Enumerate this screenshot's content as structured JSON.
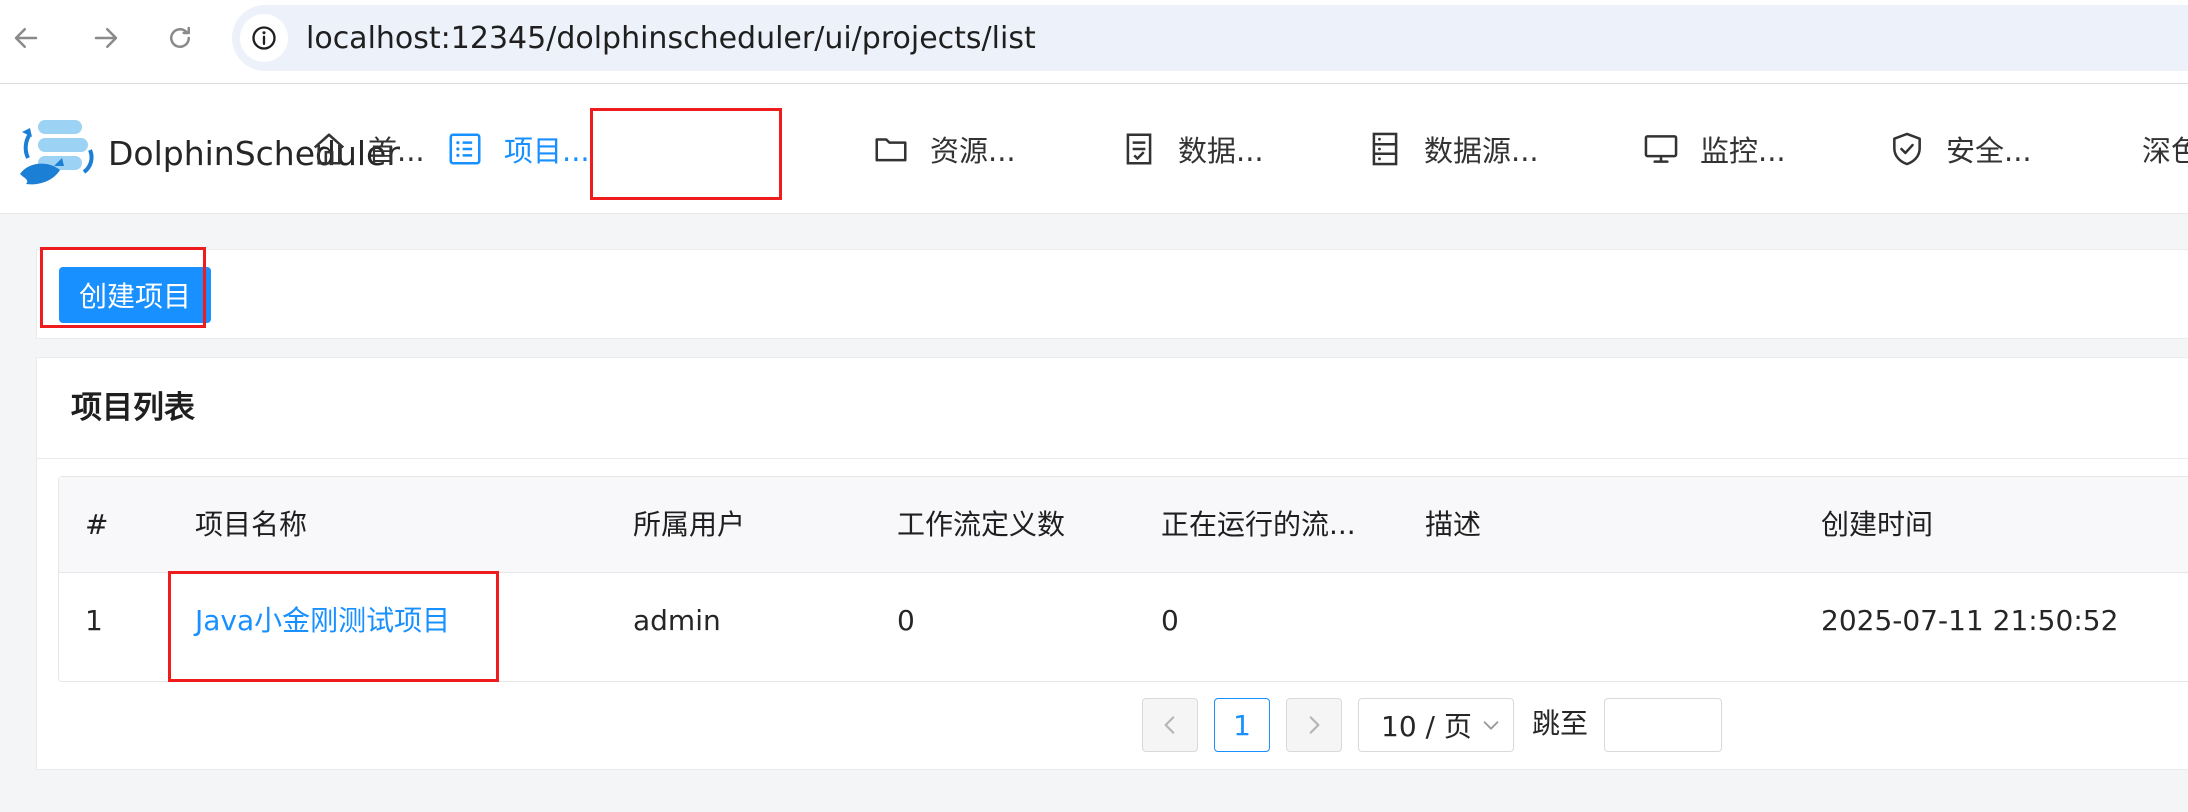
{
  "browser": {
    "url": "localhost:12345/dolphinscheduler/ui/projects/list"
  },
  "app": {
    "brand": "DolphinScheduler"
  },
  "menu": [
    {
      "label": "首...",
      "icon": "home-icon"
    },
    {
      "label": "项目...",
      "icon": "list-icon",
      "active": true
    },
    {
      "label": "资源...",
      "icon": "folder-icon"
    },
    {
      "label": "数据...",
      "icon": "document-icon"
    },
    {
      "label": "数据源...",
      "icon": "database-icon"
    },
    {
      "label": "监控...",
      "icon": "monitor-icon"
    },
    {
      "label": "安全...",
      "icon": "shield-icon"
    },
    {
      "label": "深色"
    }
  ],
  "toolbar": {
    "create_label": "创建项目"
  },
  "project_list": {
    "title": "项目列表",
    "columns": [
      "#",
      "项目名称",
      "所属用户",
      "工作流定义数",
      "正在运行的流...",
      "描述",
      "创建时间"
    ],
    "rows": [
      {
        "index": "1",
        "name": "Java小金刚测试项目",
        "owner": "admin",
        "workflow_count": "0",
        "running_count": "0",
        "description": "",
        "created": "2025-07-11 21:50:52"
      }
    ]
  },
  "pagination": {
    "current_page": "1",
    "page_size": "10 / 页",
    "jump_label": "跳至",
    "jump_value": ""
  },
  "colors": {
    "accent": "#1890ff",
    "highlight": "#ee1c1c"
  }
}
